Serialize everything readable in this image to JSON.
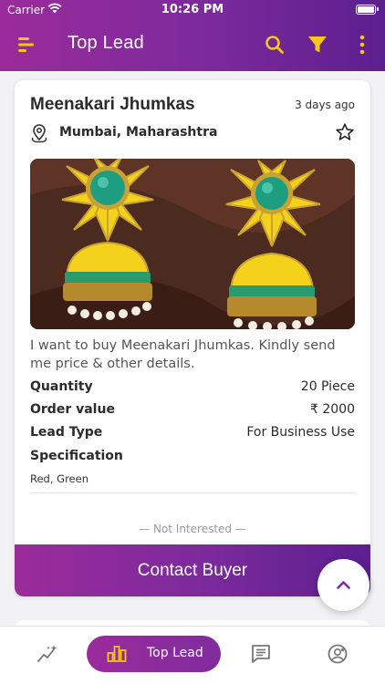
{
  "status_bar": {
    "carrier": "Carrier",
    "time": "10:26 PM"
  },
  "nav": {
    "title": "Top Lead",
    "icons": [
      "menu-icon",
      "search-icon",
      "filter-icon",
      "more-vertical-icon"
    ],
    "accent_color": "#f5c518"
  },
  "lead": {
    "title": "Meenakari Jhumkas",
    "posted": "3 days ago",
    "location": "Mumbai, Maharashtra",
    "message": " I want to buy Meenakari Jhumkas. Kindly send me price & other details.",
    "details": {
      "quantity_label": "Quantity",
      "quantity_value": "20 Piece",
      "order_label": "Order value",
      "order_value": "₹ 2000",
      "type_label": "Lead Type",
      "type_value": "For Business Use",
      "spec_label": "Specification",
      "spec_value": "Red, Green"
    },
    "not_interested": "— Not Interested —",
    "contact_button": "Contact Buyer"
  },
  "tab_bar": {
    "active_label": "Top Lead",
    "tabs": [
      "trends-icon",
      "top-lead-icon",
      "messages-icon",
      "profile-icon"
    ]
  },
  "colors": {
    "gradient_start": "#9b2b9b",
    "gradient_end": "#5c1f8e",
    "icon_gray": "#777777"
  }
}
